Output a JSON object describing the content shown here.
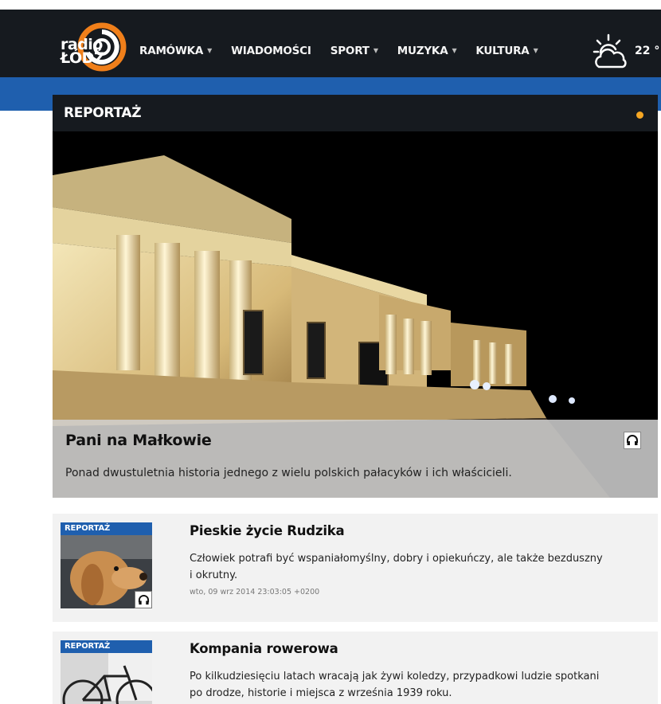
{
  "header": {
    "logo_line1": "radio",
    "logo_line2": "ŁÓDŹ",
    "nav": [
      {
        "label": "RAMÓWKA",
        "has_caret": true
      },
      {
        "label": "WIADOMOŚCI",
        "has_caret": false
      },
      {
        "label": "SPORT",
        "has_caret": true
      },
      {
        "label": "MUZYKA",
        "has_caret": true
      },
      {
        "label": "KULTURA",
        "has_caret": true
      }
    ],
    "weather_icon": "sun-cloud-icon",
    "temperature": "22 °"
  },
  "panel": {
    "title": "REPORTAŻ",
    "status_dot_color": "#f5a623"
  },
  "hero": {
    "title": "Pani na Małkowie",
    "description": "Ponad dwustuletnia historia jednego z wielu polskich pałacyków i ich właścicieli.",
    "icon": "headphones-icon"
  },
  "list": [
    {
      "badge": "REPORTAŻ",
      "title": "Pieskie życie Rudzika",
      "description": "Człowiek potrafi być wspaniałomyślny, dobry i opiekuńczy, ale także bezduszny i okrutny.",
      "date": "wto, 09 wrz 2014 23:03:05 +0200",
      "icon": "headphones-icon"
    },
    {
      "badge": "REPORTAŻ",
      "title": "Kompania rowerowa",
      "description": "Po kilkudziesięciu latach wracają jak żywi koledzy, przypadkowi ludzie spotkani po drodze, historie i miejsca z września 1939 roku."
    }
  ],
  "colors": {
    "navbar": "#161a1f",
    "brand_blue": "#1f5fae",
    "accent_orange": "#f5a623"
  }
}
